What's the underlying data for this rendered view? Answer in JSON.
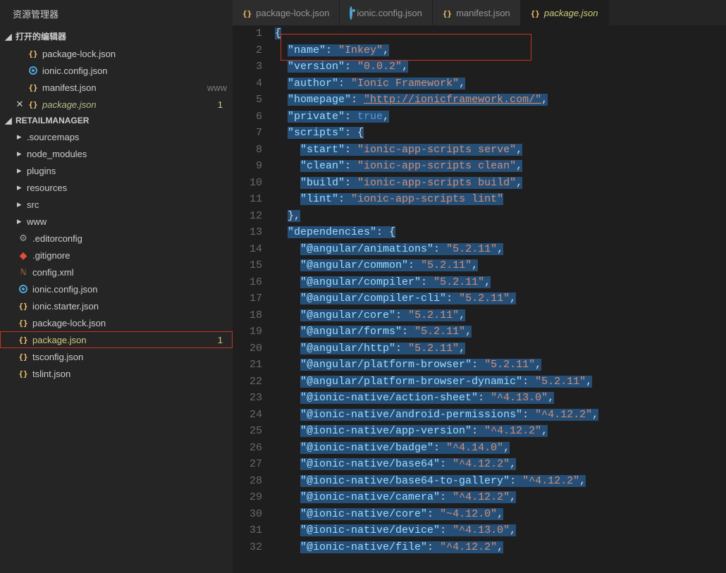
{
  "sidebar": {
    "title": "资源管理器",
    "openEditorsHeader": "打开的编辑器",
    "openEditors": [
      {
        "label": "package-lock.json",
        "iconType": "json"
      },
      {
        "label": "ionic.config.json",
        "iconType": "bullseye"
      },
      {
        "label": "manifest.json",
        "iconType": "json",
        "suffix": "www"
      },
      {
        "label": "package.json",
        "iconType": "json",
        "close": true,
        "modifiedItalic": true,
        "badge": "1"
      }
    ],
    "projectHeader": "RETAILMANAGER",
    "folders": [
      {
        "label": ".sourcemaps"
      },
      {
        "label": "node_modules"
      },
      {
        "label": "plugins"
      },
      {
        "label": "resources"
      },
      {
        "label": "src"
      },
      {
        "label": "www"
      }
    ],
    "files": [
      {
        "label": ".editorconfig",
        "iconType": "gear"
      },
      {
        "label": ".gitignore",
        "iconType": "git"
      },
      {
        "label": "config.xml",
        "iconType": "xml"
      },
      {
        "label": "ionic.config.json",
        "iconType": "bullseye"
      },
      {
        "label": "ionic.starter.json",
        "iconType": "json"
      },
      {
        "label": "package-lock.json",
        "iconType": "json"
      },
      {
        "label": "package.json",
        "iconType": "json",
        "modified": true,
        "badge": "1",
        "highlight": true
      },
      {
        "label": "tsconfig.json",
        "iconType": "json"
      },
      {
        "label": "tslint.json",
        "iconType": "json"
      }
    ]
  },
  "tabs": [
    {
      "label": "package-lock.json",
      "iconType": "json"
    },
    {
      "label": "ionic.config.json",
      "iconType": "bullseye"
    },
    {
      "label": "manifest.json",
      "iconType": "json"
    },
    {
      "label": "package.json",
      "iconType": "json",
      "active": true,
      "modified": true
    }
  ],
  "code": {
    "lines": [
      {
        "n": 1,
        "indent": "",
        "segs": [
          {
            "t": "pun",
            "v": "{"
          }
        ],
        "sel": true
      },
      {
        "n": 2,
        "indent": "  ",
        "segs": [
          {
            "t": "key",
            "v": "\"name\""
          },
          {
            "t": "pun",
            "v": ": "
          },
          {
            "t": "str",
            "v": "\"Inkey\""
          },
          {
            "t": "pun",
            "v": ","
          }
        ],
        "sel": true
      },
      {
        "n": 3,
        "indent": "  ",
        "segs": [
          {
            "t": "key",
            "v": "\"version\""
          },
          {
            "t": "pun",
            "v": ": "
          },
          {
            "t": "str",
            "v": "\"0.0.2\""
          },
          {
            "t": "pun",
            "v": ","
          }
        ],
        "sel": true
      },
      {
        "n": 4,
        "indent": "  ",
        "segs": [
          {
            "t": "key",
            "v": "\"author\""
          },
          {
            "t": "pun",
            "v": ": "
          },
          {
            "t": "str",
            "v": "\"Ionic Framework\""
          },
          {
            "t": "pun",
            "v": ","
          }
        ],
        "sel": true
      },
      {
        "n": 5,
        "indent": "  ",
        "segs": [
          {
            "t": "key",
            "v": "\"homepage\""
          },
          {
            "t": "pun",
            "v": ": "
          },
          {
            "t": "link",
            "v": "\"http://ionicframework.com/\""
          },
          {
            "t": "pun",
            "v": ","
          }
        ],
        "sel": true
      },
      {
        "n": 6,
        "indent": "  ",
        "segs": [
          {
            "t": "key",
            "v": "\"private\""
          },
          {
            "t": "pun",
            "v": ": "
          },
          {
            "t": "kw",
            "v": "true"
          },
          {
            "t": "pun",
            "v": ","
          }
        ],
        "sel": true
      },
      {
        "n": 7,
        "indent": "  ",
        "segs": [
          {
            "t": "key",
            "v": "\"scripts\""
          },
          {
            "t": "pun",
            "v": ": {"
          }
        ],
        "sel": true
      },
      {
        "n": 8,
        "indent": "    ",
        "segs": [
          {
            "t": "key",
            "v": "\"start\""
          },
          {
            "t": "pun",
            "v": ": "
          },
          {
            "t": "str",
            "v": "\"ionic-app-scripts serve\""
          },
          {
            "t": "pun",
            "v": ","
          }
        ],
        "sel": true
      },
      {
        "n": 9,
        "indent": "    ",
        "segs": [
          {
            "t": "key",
            "v": "\"clean\""
          },
          {
            "t": "pun",
            "v": ": "
          },
          {
            "t": "str",
            "v": "\"ionic-app-scripts clean\""
          },
          {
            "t": "pun",
            "v": ","
          }
        ],
        "sel": true
      },
      {
        "n": 10,
        "indent": "    ",
        "segs": [
          {
            "t": "key",
            "v": "\"build\""
          },
          {
            "t": "pun",
            "v": ": "
          },
          {
            "t": "str",
            "v": "\"ionic-app-scripts build\""
          },
          {
            "t": "pun",
            "v": ","
          }
        ],
        "sel": true
      },
      {
        "n": 11,
        "indent": "    ",
        "segs": [
          {
            "t": "key",
            "v": "\"lint\""
          },
          {
            "t": "pun",
            "v": ": "
          },
          {
            "t": "str",
            "v": "\"ionic-app-scripts lint\""
          }
        ],
        "sel": true
      },
      {
        "n": 12,
        "indent": "  ",
        "segs": [
          {
            "t": "pun",
            "v": "},"
          }
        ],
        "sel": true
      },
      {
        "n": 13,
        "indent": "  ",
        "segs": [
          {
            "t": "key",
            "v": "\"dependencies\""
          },
          {
            "t": "pun",
            "v": ": {"
          }
        ],
        "sel": true
      },
      {
        "n": 14,
        "indent": "    ",
        "segs": [
          {
            "t": "key",
            "v": "\"@angular/animations\""
          },
          {
            "t": "pun",
            "v": ": "
          },
          {
            "t": "str",
            "v": "\"5.2.11\""
          },
          {
            "t": "pun",
            "v": ","
          }
        ],
        "sel": true
      },
      {
        "n": 15,
        "indent": "    ",
        "segs": [
          {
            "t": "key",
            "v": "\"@angular/common\""
          },
          {
            "t": "pun",
            "v": ": "
          },
          {
            "t": "str",
            "v": "\"5.2.11\""
          },
          {
            "t": "pun",
            "v": ","
          }
        ],
        "sel": true
      },
      {
        "n": 16,
        "indent": "    ",
        "segs": [
          {
            "t": "key",
            "v": "\"@angular/compiler\""
          },
          {
            "t": "pun",
            "v": ": "
          },
          {
            "t": "str",
            "v": "\"5.2.11\""
          },
          {
            "t": "pun",
            "v": ","
          }
        ],
        "sel": true
      },
      {
        "n": 17,
        "indent": "    ",
        "segs": [
          {
            "t": "key",
            "v": "\"@angular/compiler-cli\""
          },
          {
            "t": "pun",
            "v": ": "
          },
          {
            "t": "str",
            "v": "\"5.2.11\""
          },
          {
            "t": "pun",
            "v": ","
          }
        ],
        "sel": true
      },
      {
        "n": 18,
        "indent": "    ",
        "segs": [
          {
            "t": "key",
            "v": "\"@angular/core\""
          },
          {
            "t": "pun",
            "v": ": "
          },
          {
            "t": "str",
            "v": "\"5.2.11\""
          },
          {
            "t": "pun",
            "v": ","
          }
        ],
        "sel": true
      },
      {
        "n": 19,
        "indent": "    ",
        "segs": [
          {
            "t": "key",
            "v": "\"@angular/forms\""
          },
          {
            "t": "pun",
            "v": ": "
          },
          {
            "t": "str",
            "v": "\"5.2.11\""
          },
          {
            "t": "pun",
            "v": ","
          }
        ],
        "sel": true
      },
      {
        "n": 20,
        "indent": "    ",
        "segs": [
          {
            "t": "key",
            "v": "\"@angular/http\""
          },
          {
            "t": "pun",
            "v": ": "
          },
          {
            "t": "str",
            "v": "\"5.2.11\""
          },
          {
            "t": "pun",
            "v": ","
          }
        ],
        "sel": true
      },
      {
        "n": 21,
        "indent": "    ",
        "segs": [
          {
            "t": "key",
            "v": "\"@angular/platform-browser\""
          },
          {
            "t": "pun",
            "v": ": "
          },
          {
            "t": "str",
            "v": "\"5.2.11\""
          },
          {
            "t": "pun",
            "v": ","
          }
        ],
        "sel": true
      },
      {
        "n": 22,
        "indent": "    ",
        "segs": [
          {
            "t": "key",
            "v": "\"@angular/platform-browser-dynamic\""
          },
          {
            "t": "pun",
            "v": ": "
          },
          {
            "t": "str",
            "v": "\"5.2.11\""
          },
          {
            "t": "pun",
            "v": ","
          }
        ],
        "sel": true
      },
      {
        "n": 23,
        "indent": "    ",
        "segs": [
          {
            "t": "key",
            "v": "\"@ionic-native/action-sheet\""
          },
          {
            "t": "pun",
            "v": ": "
          },
          {
            "t": "str",
            "v": "\"^4.13.0\""
          },
          {
            "t": "pun",
            "v": ","
          }
        ],
        "sel": true
      },
      {
        "n": 24,
        "indent": "    ",
        "segs": [
          {
            "t": "key",
            "v": "\"@ionic-native/android-permissions\""
          },
          {
            "t": "pun",
            "v": ": "
          },
          {
            "t": "str",
            "v": "\"^4.12.2\""
          },
          {
            "t": "pun",
            "v": ","
          }
        ],
        "sel": true
      },
      {
        "n": 25,
        "indent": "    ",
        "segs": [
          {
            "t": "key",
            "v": "\"@ionic-native/app-version\""
          },
          {
            "t": "pun",
            "v": ": "
          },
          {
            "t": "str",
            "v": "\"^4.12.2\""
          },
          {
            "t": "pun",
            "v": ","
          }
        ],
        "sel": true
      },
      {
        "n": 26,
        "indent": "    ",
        "segs": [
          {
            "t": "key",
            "v": "\"@ionic-native/badge\""
          },
          {
            "t": "pun",
            "v": ": "
          },
          {
            "t": "str",
            "v": "\"^4.14.0\""
          },
          {
            "t": "pun",
            "v": ","
          }
        ],
        "sel": true
      },
      {
        "n": 27,
        "indent": "    ",
        "segs": [
          {
            "t": "key",
            "v": "\"@ionic-native/base64\""
          },
          {
            "t": "pun",
            "v": ": "
          },
          {
            "t": "str",
            "v": "\"^4.12.2\""
          },
          {
            "t": "pun",
            "v": ","
          }
        ],
        "sel": true
      },
      {
        "n": 28,
        "indent": "    ",
        "segs": [
          {
            "t": "key",
            "v": "\"@ionic-native/base64-to-gallery\""
          },
          {
            "t": "pun",
            "v": ": "
          },
          {
            "t": "str",
            "v": "\"^4.12.2\""
          },
          {
            "t": "pun",
            "v": ","
          }
        ],
        "sel": true
      },
      {
        "n": 29,
        "indent": "    ",
        "segs": [
          {
            "t": "key",
            "v": "\"@ionic-native/camera\""
          },
          {
            "t": "pun",
            "v": ": "
          },
          {
            "t": "str",
            "v": "\"^4.12.2\""
          },
          {
            "t": "pun",
            "v": ","
          }
        ],
        "sel": true
      },
      {
        "n": 30,
        "indent": "    ",
        "segs": [
          {
            "t": "key",
            "v": "\"@ionic-native/core\""
          },
          {
            "t": "pun",
            "v": ": "
          },
          {
            "t": "str",
            "v": "\"~4.12.0\""
          },
          {
            "t": "pun",
            "v": ","
          }
        ],
        "sel": true
      },
      {
        "n": 31,
        "indent": "    ",
        "segs": [
          {
            "t": "key",
            "v": "\"@ionic-native/device\""
          },
          {
            "t": "pun",
            "v": ": "
          },
          {
            "t": "str",
            "v": "\"^4.13.0\""
          },
          {
            "t": "pun",
            "v": ","
          }
        ],
        "sel": true
      },
      {
        "n": 32,
        "indent": "    ",
        "segs": [
          {
            "t": "key",
            "v": "\"@ionic-native/file\""
          },
          {
            "t": "pun",
            "v": ": "
          },
          {
            "t": "str",
            "v": "\"^4.12.2\""
          },
          {
            "t": "pun",
            "v": ","
          }
        ],
        "sel": true
      }
    ]
  }
}
